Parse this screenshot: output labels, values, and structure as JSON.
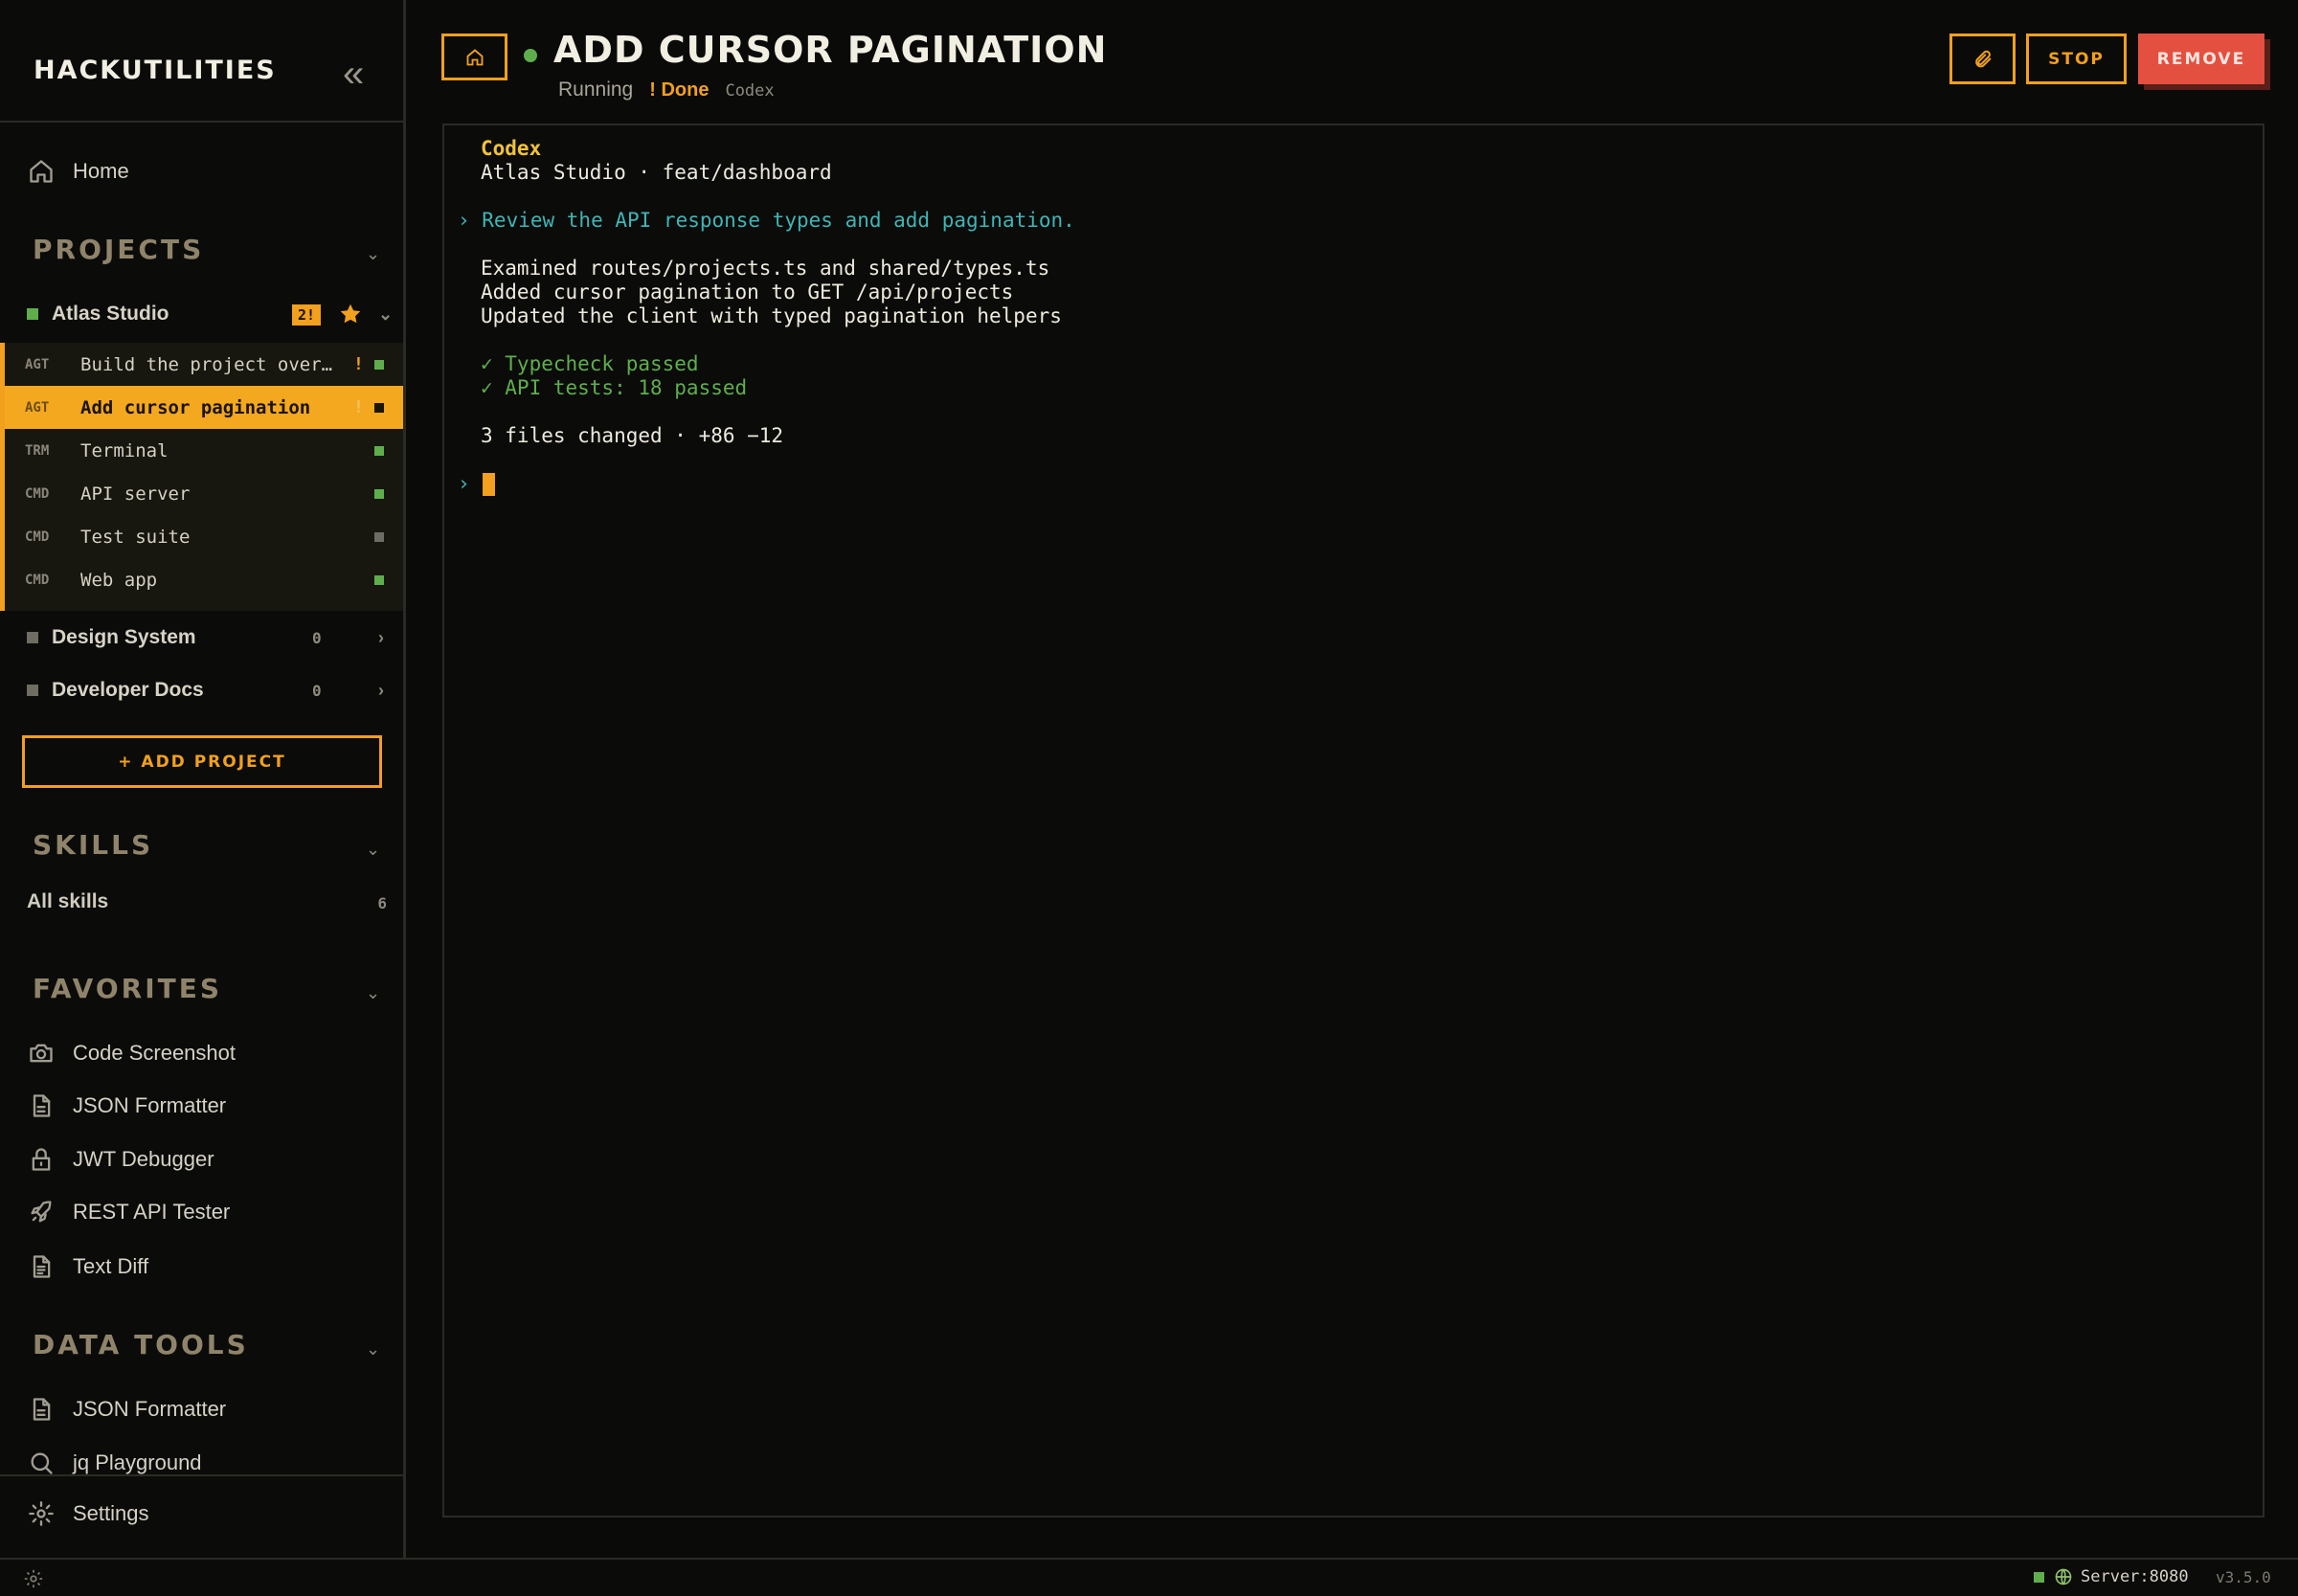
{
  "app": {
    "brand": "HACKUTILITIES",
    "collapse_glyph": "«"
  },
  "nav": {
    "home_label": "Home",
    "settings_label": "Settings"
  },
  "projects": {
    "header": "PROJECTS",
    "add_label": "+ ADD PROJECT",
    "items": [
      {
        "name": "Atlas Studio",
        "badge": "2!",
        "status_color": "#5fae4c",
        "expanded": true
      },
      {
        "name": "Design System",
        "count": "0",
        "status_color": "#6f6c63"
      },
      {
        "name": "Developer Docs",
        "count": "0",
        "status_color": "#6f6c63"
      }
    ],
    "tasks": [
      {
        "kind": "AGT",
        "name": "Build the project overview",
        "flag": "!",
        "status_color": "#5fae4c"
      },
      {
        "kind": "AGT",
        "name": "Add cursor pagination",
        "flag": "!",
        "status_color": "#1a1404",
        "active": true
      },
      {
        "kind": "TRM",
        "name": "Terminal",
        "status_color": "#5fae4c"
      },
      {
        "kind": "CMD",
        "name": "API server",
        "status_color": "#5fae4c"
      },
      {
        "kind": "CMD",
        "name": "Test suite",
        "status_color": "#6f6c63"
      },
      {
        "kind": "CMD",
        "name": "Web app",
        "status_color": "#5fae4c"
      }
    ]
  },
  "skills": {
    "header": "SKILLS",
    "all_label": "All skills",
    "all_count": "6"
  },
  "favorites": {
    "header": "FAVORITES",
    "items": [
      {
        "label": "Code Screenshot",
        "icon": "camera-icon"
      },
      {
        "label": "JSON Formatter",
        "icon": "file-icon"
      },
      {
        "label": "JWT Debugger",
        "icon": "lock-icon"
      },
      {
        "label": "REST API Tester",
        "icon": "rocket-icon"
      },
      {
        "label": "Text Diff",
        "icon": "file-text-icon"
      }
    ]
  },
  "data_tools": {
    "header": "DATA TOOLS",
    "items": [
      {
        "label": "JSON Formatter",
        "icon": "file-icon"
      },
      {
        "label": "jq Playground",
        "icon": "search-icon"
      }
    ]
  },
  "header": {
    "title": "ADD CURSOR PAGINATION",
    "status": "Running",
    "done": "! Done",
    "agent": "Codex",
    "stop_label": "STOP",
    "remove_label": "REMOVE"
  },
  "terminal": {
    "agent": "Codex",
    "context": "Atlas Studio · feat/dashboard",
    "prompt_marker": "›",
    "prompt": "› Review the API response types and add pagination.",
    "output": [
      "Examined routes/projects.ts and shared/types.ts",
      "Added cursor pagination to GET /api/projects",
      "Updated the client with typed pagination helpers"
    ],
    "checks": [
      "✓ Typecheck passed",
      "✓ API tests: 18 passed"
    ],
    "summary": "3 files changed · +86 −12"
  },
  "statusbar": {
    "server": "Server:8080",
    "version": "v3.5.0"
  },
  "colors": {
    "accent": "#f2a01d",
    "ok": "#5fae4c",
    "danger": "#e4503f",
    "prompt": "#3fb5b5"
  }
}
